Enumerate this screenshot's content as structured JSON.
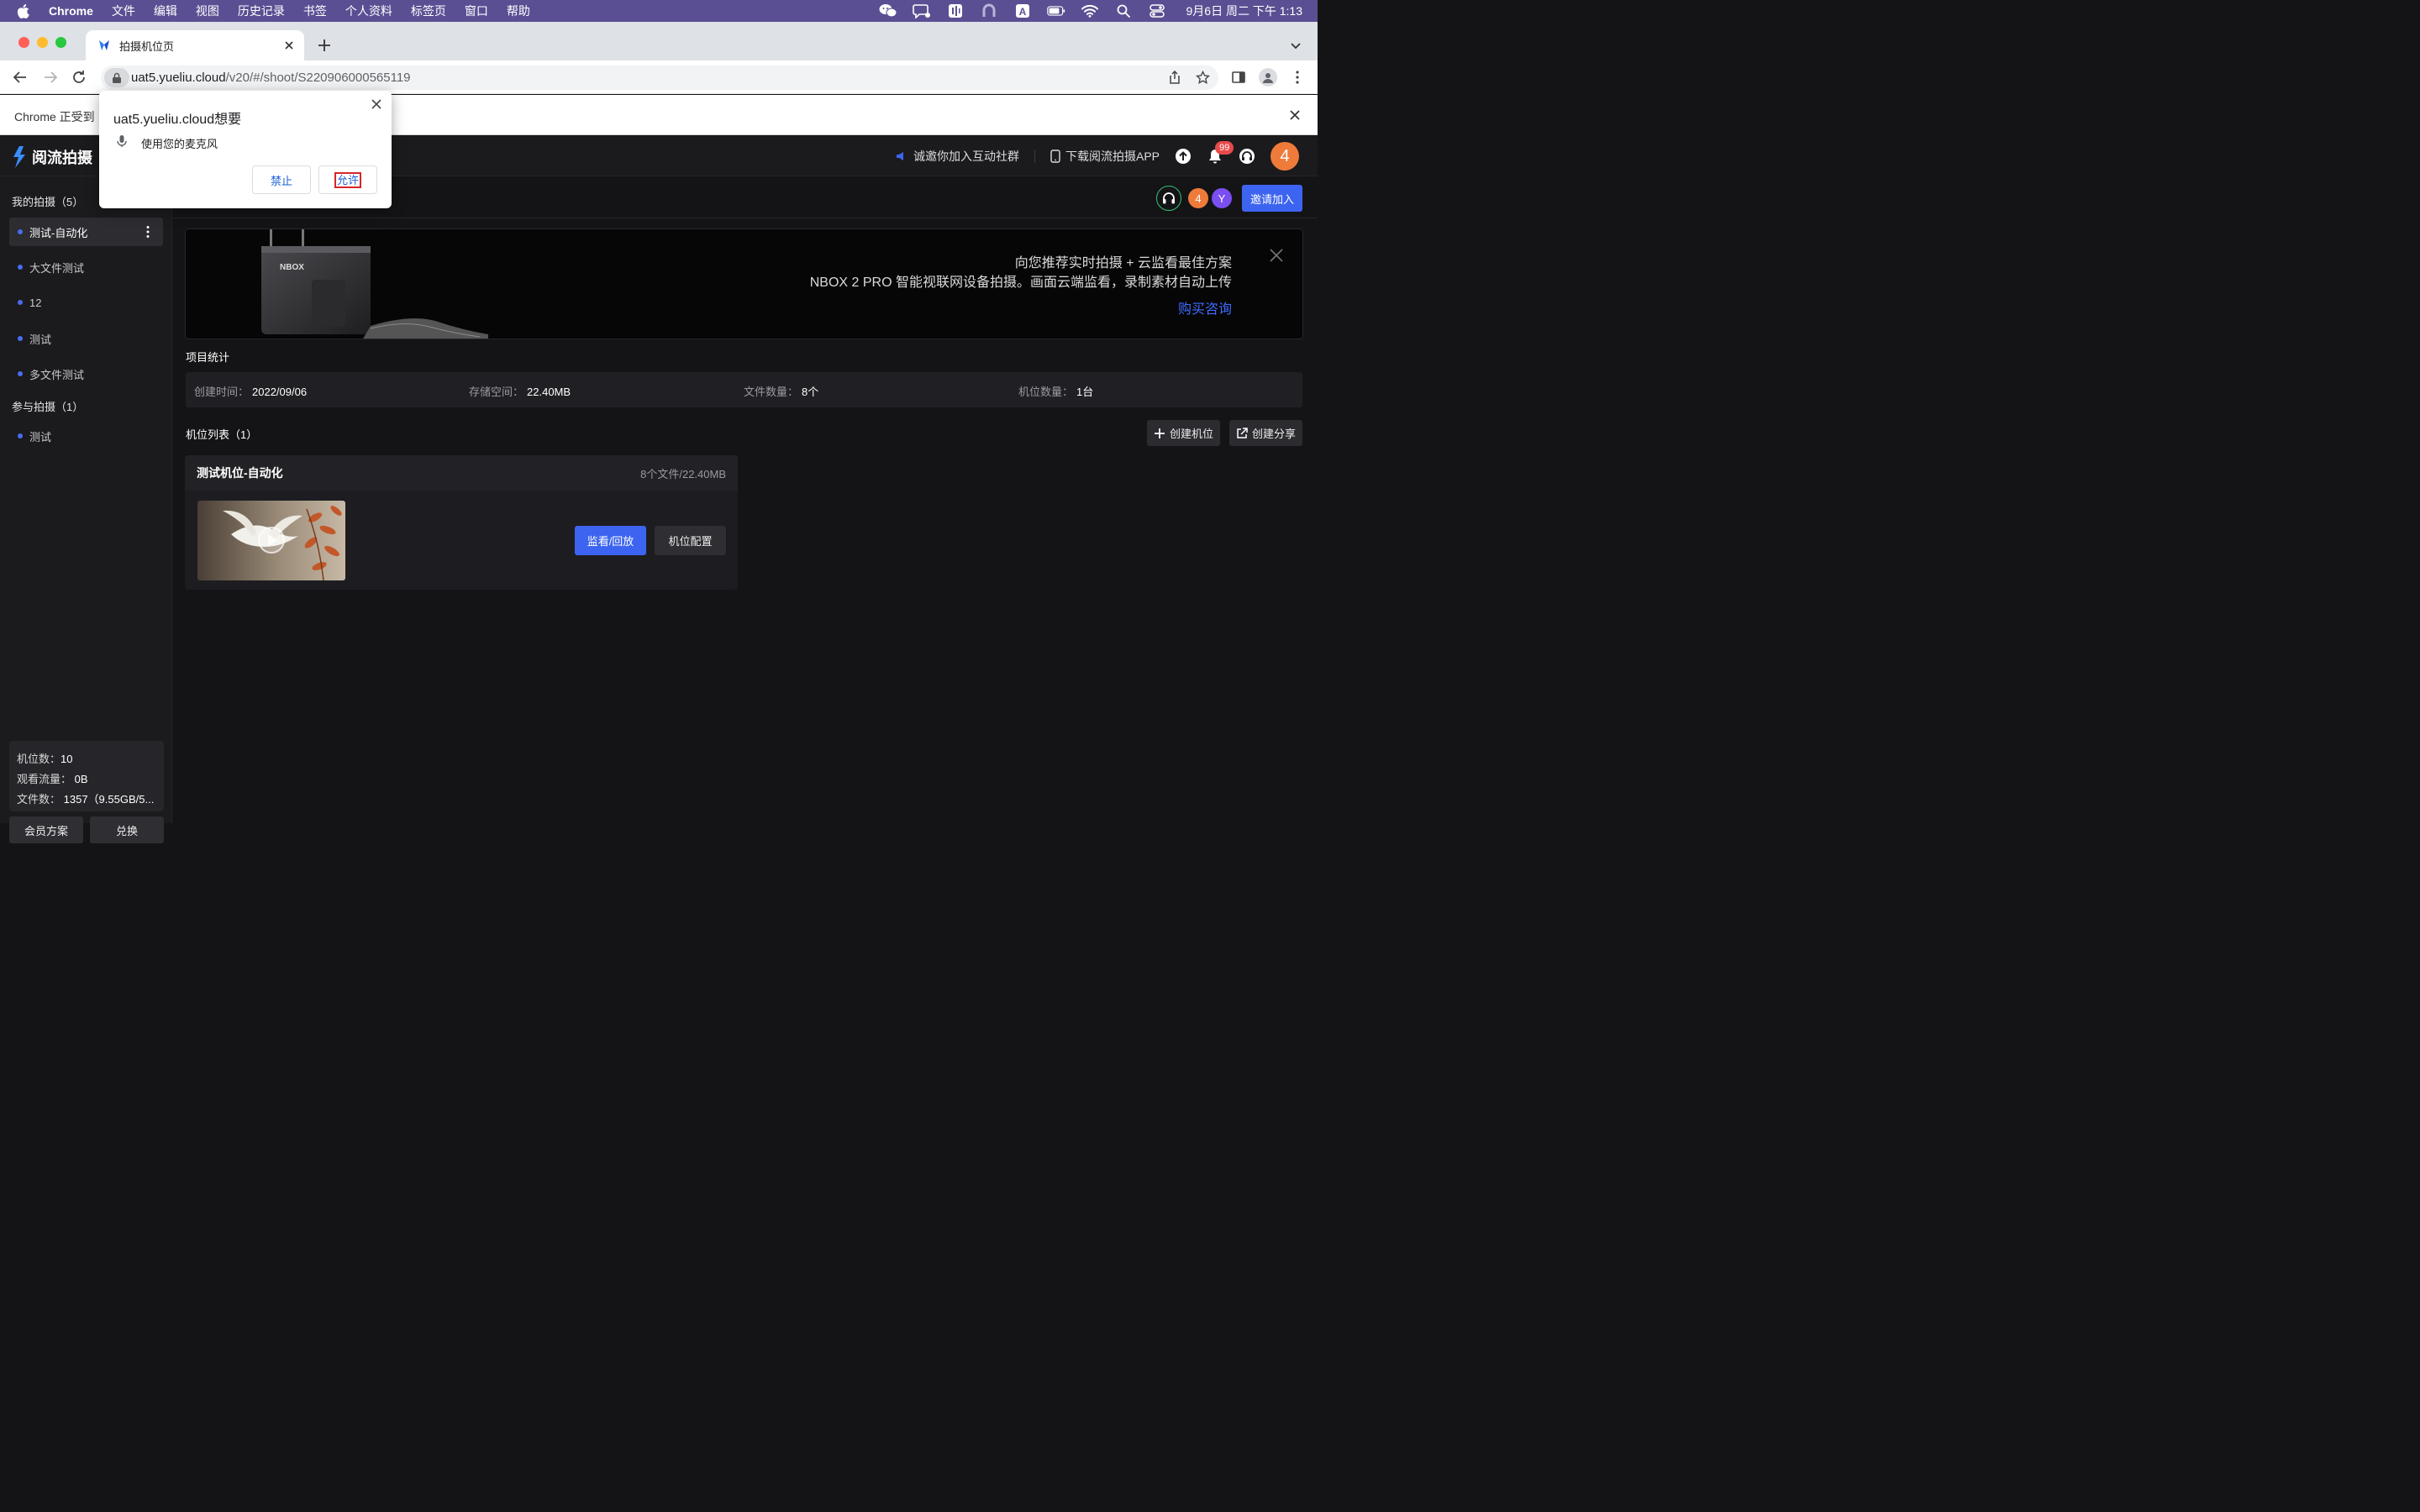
{
  "menubar": {
    "app_name": "Chrome",
    "items": [
      "文件",
      "编辑",
      "视图",
      "历史记录",
      "书签",
      "个人资料",
      "标签页",
      "窗口",
      "帮助"
    ],
    "clock": "9月6日 周二 下午 1:13"
  },
  "tab": {
    "title": "拍摄机位页"
  },
  "omnibox": {
    "host": "uat5.yueliu.cloud",
    "path": "/v20/#/shoot/S220906000565119"
  },
  "infobar": {
    "message": "Chrome 正受到"
  },
  "popup": {
    "title": "uat5.yueliu.cloud想要",
    "message": "使用您的麦克风",
    "deny": "禁止",
    "allow": "允许"
  },
  "app": {
    "brand": "阅流拍摄",
    "header": {
      "promo": "诚邀你加入互动社群",
      "download": "下载阅流拍摄APP",
      "notif_count": "99",
      "avatar": "4"
    },
    "sidebar": {
      "my_shoots": "我的拍摄（5）",
      "my_items": [
        "测试-自动化",
        "大文件测试",
        "12",
        "测试",
        "多文件测试"
      ],
      "joined": "参与拍摄（1）",
      "joined_items": [
        "测试"
      ],
      "stats": {
        "cams_label": "机位数：",
        "cams": "10",
        "traffic_label": "观看流量：",
        "traffic": "0B",
        "files_label": "文件数：",
        "files": "1357（9.55GB/5..."
      },
      "plan_btn": "会员方案",
      "redeem_btn": "兑换"
    },
    "topbar": {
      "avatar_1": "4",
      "avatar_2": "Y",
      "invite": "邀请加入"
    },
    "banner": {
      "title": "向您推荐实时拍摄 + 云监看最佳方案",
      "desc": "NBOX 2 PRO 智能视联网设备拍摄。画面云端监看，录制素材自动上传",
      "link": "购买咨询",
      "device_label": "NBOX"
    },
    "project_stats": {
      "title": "项目统计",
      "created_label": "创建时间：",
      "created": "2022/09/06",
      "storage_label": "存储空间：",
      "storage": "22.40MB",
      "files_label": "文件数量：",
      "files": "8个",
      "cams_label": "机位数量：",
      "cams": "1台"
    },
    "cam_list": {
      "title": "机位列表（1）",
      "create_btn": "创建机位",
      "share_btn": "创建分享",
      "card": {
        "name": "测试机位-自动化",
        "meta": "8个文件/22.40MB",
        "monitor_btn": "监看/回放",
        "config_btn": "机位配置"
      }
    }
  },
  "colors": {
    "accent": "#3d64f0",
    "menubar": "#5b4f93",
    "badge": "#e84a4a",
    "avatar": "#ef7b3a"
  }
}
